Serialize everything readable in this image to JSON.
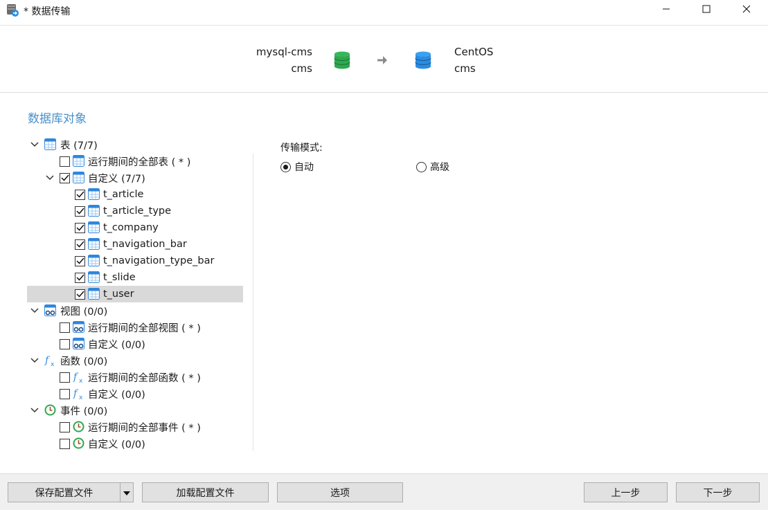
{
  "window": {
    "title": "* 数据传输",
    "icon": "data-transfer-icon",
    "controls": [
      "minimize-icon",
      "maximize-icon",
      "close-icon"
    ]
  },
  "connection": {
    "source": {
      "connection": "mysql-cms",
      "database": "cms",
      "icon": "green-database-icon"
    },
    "arrow_icon": "arrow-right-icon",
    "target": {
      "connection": "CentOS",
      "database": "cms",
      "icon": "blue-database-icon"
    }
  },
  "objects": {
    "heading": "数据库对象",
    "tables": {
      "label": "表 (7/7)",
      "all_runtime": "运行期间的全部表 ( * )",
      "custom": "自定义 (7/7)",
      "items": [
        "t_article",
        "t_article_type",
        "t_company",
        "t_navigation_bar",
        "t_navigation_type_bar",
        "t_slide",
        "t_user"
      ],
      "selected_item": "t_user"
    },
    "views": {
      "label": "视图 (0/0)",
      "all_runtime": "运行期间的全部视图 ( * )",
      "custom": "自定义 (0/0)"
    },
    "functions": {
      "label": "函数 (0/0)",
      "all_runtime": "运行期间的全部函数 ( * )",
      "custom": "自定义 (0/0)"
    },
    "events": {
      "label": "事件 (0/0)",
      "all_runtime": "运行期间的全部事件 ( * )",
      "custom": "自定义 (0/0)"
    }
  },
  "transfer_mode": {
    "label": "传输模式:",
    "options": [
      "自动",
      "高级"
    ],
    "selected": "自动"
  },
  "buttons": {
    "save_profile": "保存配置文件",
    "load_profile": "加载配置文件",
    "options": "选项",
    "back": "上一步",
    "next": "下一步"
  },
  "colors": {
    "accent": "#4a90c8",
    "table_icon": "#2e86de",
    "source_db": "#2fa84f",
    "target_db": "#2b8de0",
    "selection": "#d9d9d9"
  }
}
